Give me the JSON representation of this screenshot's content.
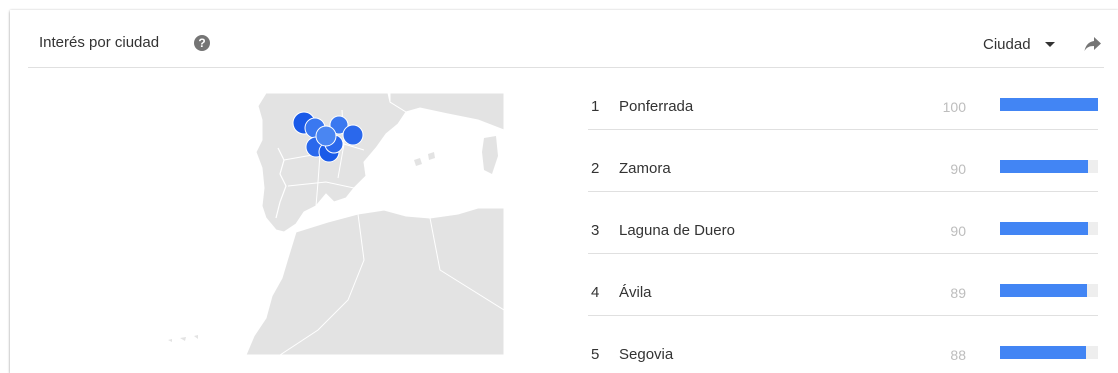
{
  "header": {
    "title": "Interés por ciudad",
    "help_icon": "help-circle-icon",
    "dropdown_label": "Ciudad",
    "share_icon": "share-arrow-icon"
  },
  "colors": {
    "bar": "#4285f4",
    "bar_track": "#eeeeee",
    "map_land": "#e3e3e3",
    "map_marker": "#1a5ae8"
  },
  "cities": [
    {
      "rank": "1",
      "name": "Ponferrada",
      "value": "100",
      "fraction": 1.0
    },
    {
      "rank": "2",
      "name": "Zamora",
      "value": "90",
      "fraction": 0.9
    },
    {
      "rank": "3",
      "name": "Laguna de Duero",
      "value": "90",
      "fraction": 0.9
    },
    {
      "rank": "4",
      "name": "Ávila",
      "value": "89",
      "fraction": 0.89
    },
    {
      "rank": "5",
      "name": "Segovia",
      "value": "88",
      "fraction": 0.88
    }
  ]
}
